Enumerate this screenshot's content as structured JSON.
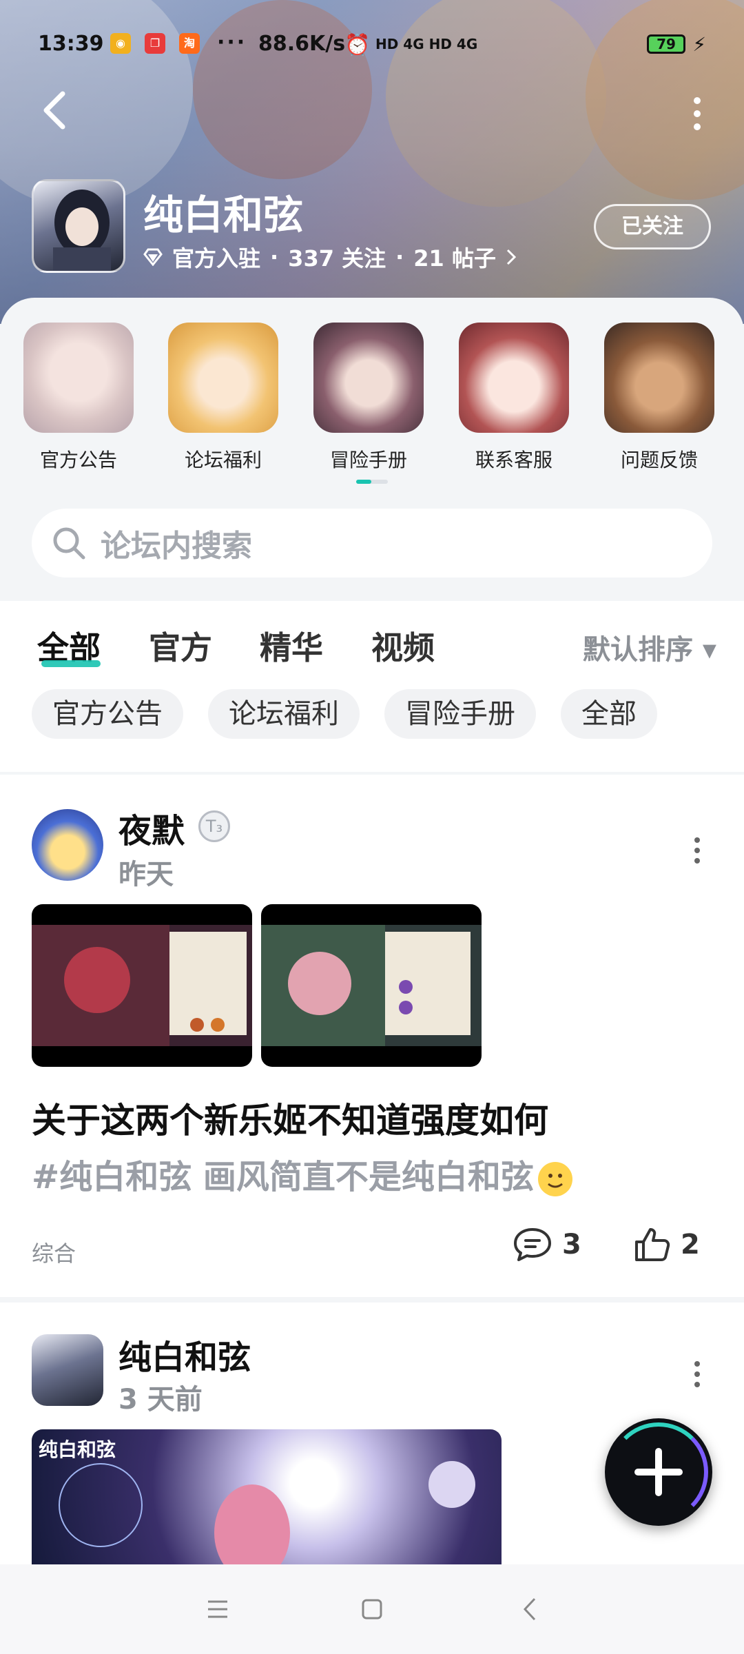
{
  "status_bar": {
    "time": "13:39",
    "dots": "···",
    "network_speed": "88.6K/s",
    "network_badges": "HD 4G HD 4G",
    "battery": "79"
  },
  "forum": {
    "name": "纯白和弦",
    "meta_official": "官方入驻",
    "meta_follow": "337 关注",
    "meta_posts": "21 帖子",
    "meta_dot": "·",
    "follow_button": "已关注"
  },
  "shortcuts": [
    {
      "label": "官方公告",
      "color": "#f2d8d6"
    },
    {
      "label": "论坛福利",
      "color": "#f4d29a"
    },
    {
      "label": "冒险手册",
      "color": "#6a4a55"
    },
    {
      "label": "联系客服",
      "color": "#9b4a4a"
    },
    {
      "label": "问题反馈",
      "color": "#c88a5a"
    }
  ],
  "search": {
    "placeholder": "论坛内搜索"
  },
  "tabs": [
    {
      "label": "全部"
    },
    {
      "label": "官方"
    },
    {
      "label": "精华"
    },
    {
      "label": "视频"
    }
  ],
  "sort_label": "默认排序 ▾",
  "chips": [
    {
      "label": "官方公告"
    },
    {
      "label": "论坛福利"
    },
    {
      "label": "冒险手册"
    },
    {
      "label": "全部"
    }
  ],
  "posts": [
    {
      "author": "夜默",
      "level": "T₃",
      "time": "昨天",
      "title": "关于这两个新乐姬不知道强度如何",
      "tags": "#纯白和弦 画风简直不是纯白和弦",
      "category": "综合",
      "comments": "3",
      "likes": "2"
    },
    {
      "author": "纯白和弦",
      "time": "3 天前",
      "banner_label": "纯白和弦"
    }
  ],
  "accent_color": "#19c3b0"
}
